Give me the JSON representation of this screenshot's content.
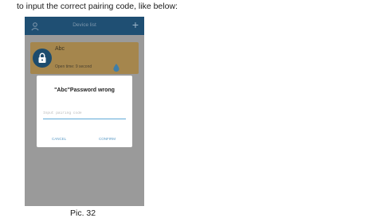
{
  "intro_text": "to input the correct pairing code, like below:",
  "app": {
    "header": {
      "title": "Device list",
      "left_icon": "user-icon",
      "right_icon": "plus-icon"
    },
    "device": {
      "name": "Abc",
      "meta": "Open time: 9 second",
      "icons": [
        "lock-icon",
        "water-drop-icon"
      ]
    },
    "dialog": {
      "title": "\"Abc\"Password wrong",
      "input_placeholder": "Input pairing code",
      "input_value": "",
      "cancel_label": "CANCEL",
      "confirm_label": "CONFIRM"
    },
    "colors": {
      "header_bg": "#1f4f73",
      "card_bg": "#a5864d",
      "overlay_bg": "#9a9a9a",
      "accent": "#5fa9d8"
    }
  },
  "caption": "Pic. 32"
}
